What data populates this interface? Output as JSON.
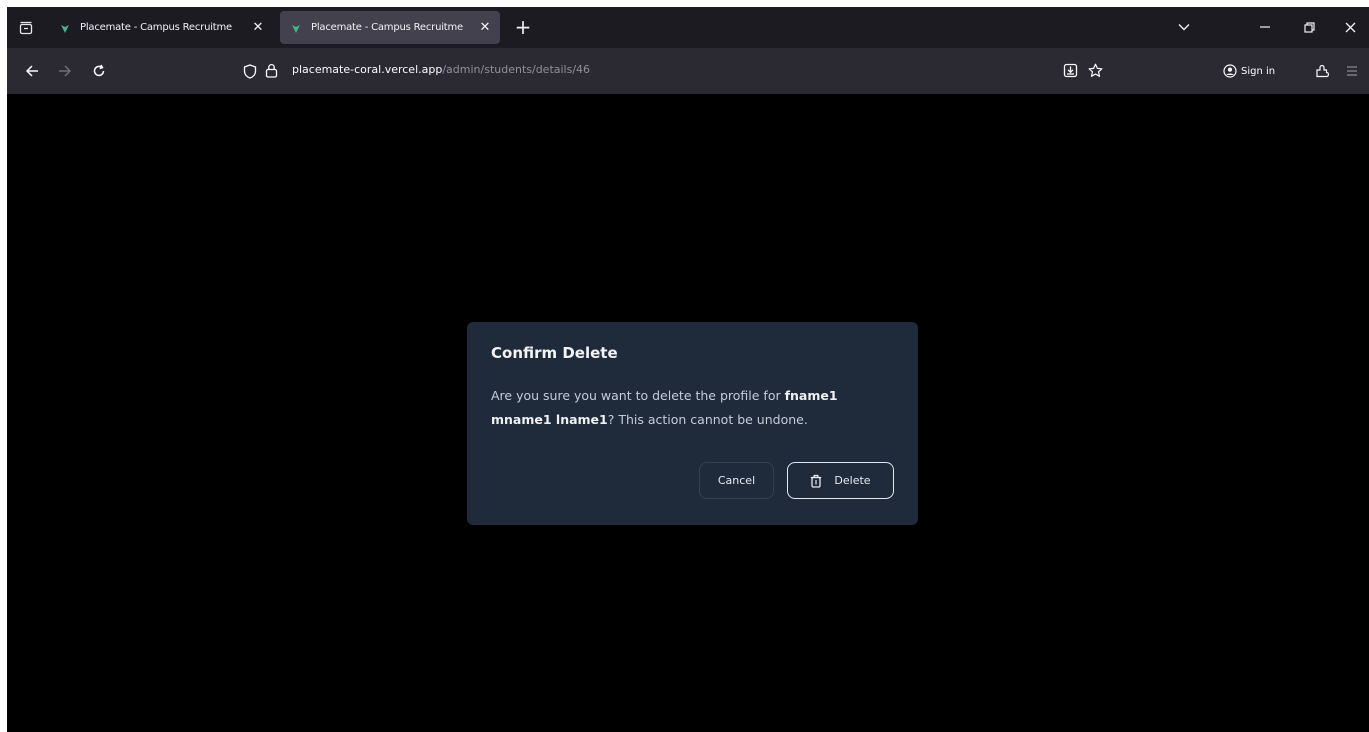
{
  "browser": {
    "tabs": [
      {
        "title": "Placemate - Campus Recruitme",
        "active": false
      },
      {
        "title": "Placemate - Campus Recruitme",
        "active": true
      }
    ],
    "url_host": "placemate-coral.vercel.app",
    "url_path": "/admin/students/details/46",
    "sign_in_label": "Sign in"
  },
  "dialog": {
    "title": "Confirm Delete",
    "message_prefix": "Are you sure you want to delete the profile for ",
    "student_name": "fname1 mname1 lname1",
    "message_suffix": "? This action cannot be undone.",
    "cancel_label": "Cancel",
    "delete_label": "Delete"
  },
  "colors": {
    "dialog_bg": "#1f2a3a",
    "page_bg": "#000000",
    "tabbar_bg": "#1c1b22",
    "navbar_bg": "#2b2a33"
  },
  "icons": [
    "tab-list-icon",
    "favicon",
    "close-icon",
    "plus-icon",
    "chevron-down-icon",
    "minimize-icon",
    "restore-icon",
    "back-arrow-icon",
    "forward-arrow-icon",
    "reload-icon",
    "shield-icon",
    "lock-icon",
    "download-icon",
    "star-icon",
    "account-icon",
    "extensions-icon",
    "menu-icon",
    "trash-icon"
  ]
}
